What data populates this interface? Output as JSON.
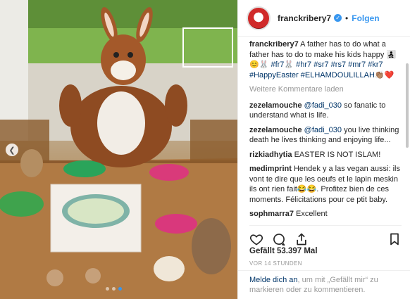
{
  "post": {
    "username": "franckribery7",
    "follow_label": "Folgen",
    "separator": "•"
  },
  "caption": {
    "username": "franckribery7",
    "text": "A father has to do what a father has to do to make his kids happy 👨‍👧‍👦😊🐰 ",
    "hashtags": "#fr7🐰 #hr7 #sr7 #rs7 #mr7 #kr7 #HappyEaster #ELHAMDOULILLAH👏🏽❤️"
  },
  "load_more_label": "Weitere Kommentare laden",
  "comments": [
    {
      "username": "zezelamouche",
      "mention": "@fadi_030",
      "text": " so fanatic to understand what is life."
    },
    {
      "username": "zezelamouche",
      "mention": "@fadi_030",
      "text": " you live thinking death he lives thinking and enjoying life..."
    },
    {
      "username": "rizkiadhytia",
      "mention": "",
      "text": " EASTER IS NOT ISLAM!"
    },
    {
      "username": "medimprint",
      "mention": "",
      "text": " Hendek y a las vegan aussi: ils vont te dire que les oeufs et le lapin meskin ils ont rien fait😂😂. Profitez bien de ces moments. Félicitations pour ce ptit baby."
    },
    {
      "username": "sophmarra7",
      "mention": "",
      "text": " Excellent"
    }
  ],
  "likes": "Gefällt 53.397 Mal",
  "timestamp": "VOR 14 STUNDEN",
  "login_prompt": {
    "link": "Melde dich an",
    "text": ", um mit „Gefällt mir“ zu markieren oder zu kommentieren."
  },
  "icons": [
    "heart-icon",
    "comment-icon",
    "share-icon",
    "bookmark-icon",
    "verified-badge-icon",
    "chevron-left-icon"
  ],
  "colors": {
    "accent": "#3897f0",
    "link": "#003569",
    "muted": "#999999"
  },
  "carousel": {
    "total": 3,
    "active": 3
  }
}
